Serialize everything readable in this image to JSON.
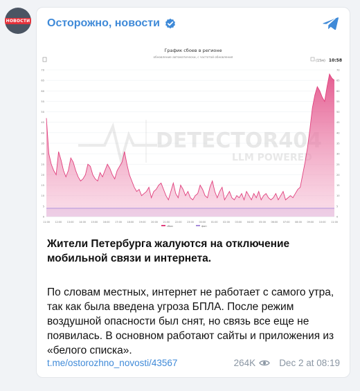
{
  "avatar": {
    "badge_text": "НОВОСТИ"
  },
  "channel": {
    "name": "Осторожно, новости",
    "accent": "#3f8ad8"
  },
  "chart": {
    "header_time": "10:58",
    "watermark_title": "DETECTOR404",
    "watermark_sub": "LLM POWERED"
  },
  "chart_data": {
    "type": "area",
    "title": "График сбоев в регионе",
    "subtitle": "обновление автоматически, с частотой обновления",
    "interval_label": "(15м)",
    "ylim": [
      0,
      70
    ],
    "y_ticks": [
      0,
      5,
      10,
      15,
      20,
      25,
      30,
      35,
      40,
      45,
      50,
      55,
      60,
      65,
      70
    ],
    "x_tick_labels": [
      "11:00",
      "12:00",
      "13:00",
      "14:00",
      "15:00",
      "16:00",
      "17:00",
      "18:00",
      "19:00",
      "20:00",
      "21:00",
      "22:00",
      "23:00",
      "00:00",
      "01:00",
      "02:00",
      "03:00",
      "04:00",
      "05:00",
      "06:00",
      "07:00",
      "08:00",
      "09:00",
      "10:00",
      "11:00"
    ],
    "series": [
      {
        "name": "сбои",
        "color": "#e0407d",
        "values": [
          47,
          30,
          25,
          22,
          20,
          31,
          27,
          22,
          19,
          22,
          28,
          26,
          22,
          19,
          17,
          18,
          20,
          25,
          24,
          20,
          18,
          17,
          21,
          19,
          22,
          25,
          23,
          20,
          18,
          22,
          24,
          26,
          31,
          25,
          20,
          17,
          14,
          12,
          13,
          10,
          11,
          12,
          14,
          9,
          12,
          13,
          15,
          16,
          13,
          10,
          8,
          12,
          16,
          11,
          9,
          15,
          13,
          10,
          12,
          9,
          8,
          10,
          11,
          15,
          13,
          10,
          9,
          14,
          17,
          12,
          9,
          12,
          14,
          8,
          10,
          12,
          9,
          8,
          10,
          9,
          11,
          8,
          12,
          10,
          8,
          11,
          9,
          12,
          8,
          10,
          11,
          9,
          8,
          9,
          11,
          8,
          10,
          12,
          8,
          9,
          10,
          9,
          11,
          13,
          14,
          20,
          26,
          33,
          42,
          52,
          58,
          62,
          60,
          57,
          55,
          62,
          68,
          66,
          65
        ]
      },
      {
        "name": "фон",
        "color": "#a78bdb",
        "values": [
          4,
          4,
          4,
          4,
          4,
          4,
          4,
          4,
          4,
          4,
          4,
          4,
          4,
          4,
          4,
          4,
          4,
          4,
          4,
          4,
          4,
          4,
          4,
          4,
          4,
          4,
          4,
          4,
          4,
          4,
          4,
          4,
          4,
          4,
          4,
          4,
          4,
          4,
          4,
          4,
          4,
          4,
          4,
          4,
          4,
          4,
          4,
          4,
          4,
          4,
          4,
          4,
          4,
          4,
          4,
          4,
          4,
          4,
          4,
          4,
          4,
          4,
          4,
          4,
          4,
          4,
          4,
          4,
          4,
          4,
          4,
          4,
          4,
          4,
          4,
          4,
          4,
          4,
          4,
          4,
          4,
          4,
          4,
          4,
          4,
          4,
          4,
          4,
          4,
          4,
          4,
          4,
          4,
          4,
          4,
          4,
          4,
          4,
          4,
          4,
          4,
          4,
          4,
          4,
          4,
          4,
          4,
          4,
          4,
          4,
          4,
          4,
          4,
          4,
          4,
          4,
          4,
          4,
          4
        ]
      }
    ],
    "legend": [
      "сбои",
      "фон"
    ],
    "legend_position": "bottom",
    "grid": true
  },
  "post": {
    "title": "Жители Петербурга жалуются на отключение мобильной связи и интернета.",
    "body": "По словам местных, интернет не работает с самого утра, так как была введена угроза БПЛА. После режим воздушной опасности был снят, но связь все еще не появилась. В основном работают сайты и приложения из «белого списка».",
    "link": "t.me/ostorozhno_novosti/43567",
    "views": "264K",
    "date": "Dec 2 at 08:19"
  }
}
